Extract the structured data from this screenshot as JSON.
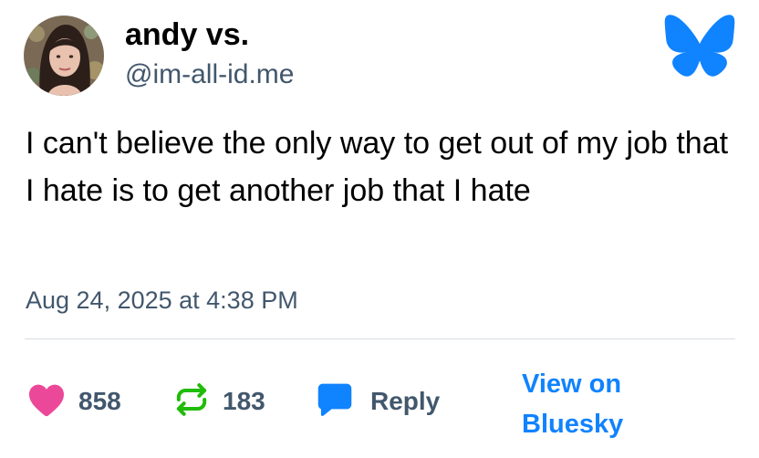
{
  "author": {
    "display_name": "andy vs.",
    "handle": "@im-all-id.me"
  },
  "post": {
    "text": "I can't believe the only way to get out of my job that I hate is to get another job that I hate",
    "timestamp": "Aug 24, 2025 at 4:38 PM"
  },
  "actions": {
    "likes": "858",
    "reposts": "183",
    "reply_label": "Reply",
    "view_label": "View on Bluesky"
  },
  "icons": {
    "logo": "bluesky-butterfly-icon",
    "like": "heart-icon",
    "repost": "repost-icon",
    "reply": "speech-bubble-icon"
  },
  "colors": {
    "brand": "#1083fe",
    "like": "#ec4899",
    "repost": "#20bc07",
    "muted_text": "#42576c"
  }
}
